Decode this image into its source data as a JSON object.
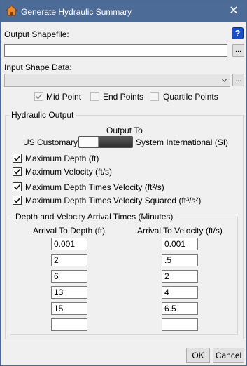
{
  "window": {
    "title": "Generate Hydraulic Summary",
    "close_glyph": "✕"
  },
  "output_shapefile": {
    "label": "Output Shapefile:",
    "value": "",
    "browse_label": "...",
    "help_label": "?"
  },
  "input_shape_data": {
    "label": "Input Shape Data:",
    "value": "",
    "browse_label": "..."
  },
  "point_options": [
    {
      "label": "Mid Point",
      "checked": true
    },
    {
      "label": "End Points",
      "checked": false
    },
    {
      "label": "Quartile Points",
      "checked": false
    }
  ],
  "hydraulic_output": {
    "title": "Hydraulic Output",
    "output_to_label": "Output To",
    "left_unit": "US Customary",
    "right_unit": "System International (SI)",
    "options": [
      {
        "label": "Maximum Depth (ft)",
        "checked": true
      },
      {
        "label": "Maximum Velocity (ft/s)",
        "checked": true
      },
      {
        "label": "Maximum Depth Times Velocity (ft²/s)",
        "checked": true
      },
      {
        "label": "Maximum Depth Times Velocity Squared (ft³/s²)",
        "checked": true
      }
    ]
  },
  "arrival_times": {
    "title": "Depth and Velocity Arrival Times (Minutes)",
    "depth_header": "Arrival To Depth (ft)",
    "velocity_header": "Arrival To Velocity (ft/s)",
    "depth_values": [
      "0.001",
      "2",
      "6",
      "13",
      "15",
      ""
    ],
    "velocity_values": [
      "0.001",
      ".5",
      "2",
      "4",
      "6.5",
      ""
    ]
  },
  "buttons": {
    "ok": "OK",
    "cancel": "Cancel"
  }
}
